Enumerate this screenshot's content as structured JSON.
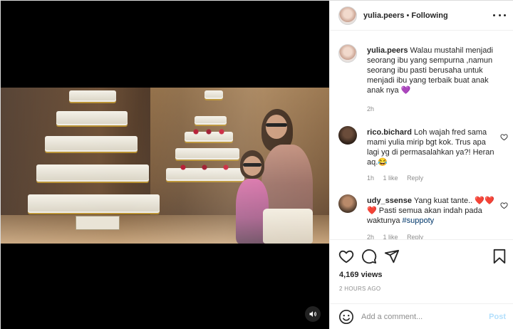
{
  "header": {
    "username": "yulia.peers",
    "separator": "•",
    "follow_status": "Following"
  },
  "caption": {
    "username": "yulia.peers",
    "text": "Walau mustahil menjadi seorang ibu yang sempurna ,namun seorang ibu pasti berusaha untuk menjadi ibu yang terbaik buat anak anak nya 💜",
    "age": "2h"
  },
  "comments": [
    {
      "username": "rico.bichard",
      "text": "Loh wajah fred sama mami yulia mirip bgt kok. Trus apa lagi yg di permasalahkan ya?! Heran aq.😂",
      "age": "1h",
      "likes": "1 like",
      "reply": "Reply"
    },
    {
      "username": "udy_ssense",
      "text_before": "Yang kuat tante.. ❤️❤️ ❤️ Pasti semua akan indah pada waktunya ",
      "hashtag": "#suppoty",
      "age": "2h",
      "likes": "1 like",
      "reply": "Reply"
    }
  ],
  "stats": {
    "views": "4,169 views",
    "posted": "2 HOURS AGO"
  },
  "add_comment": {
    "placeholder": "Add a comment...",
    "post_label": "Post"
  },
  "icons": {
    "like": "heart-icon",
    "comment": "comment-bubble-icon",
    "share": "paper-plane-icon",
    "save": "bookmark-icon",
    "more": "more-options-icon",
    "emoji": "emoji-icon",
    "audio": "speaker-icon"
  },
  "colors": {
    "link": "#00376b",
    "muted": "#8e8e8e",
    "post_button": "#b2dffc",
    "border": "#efefef"
  }
}
